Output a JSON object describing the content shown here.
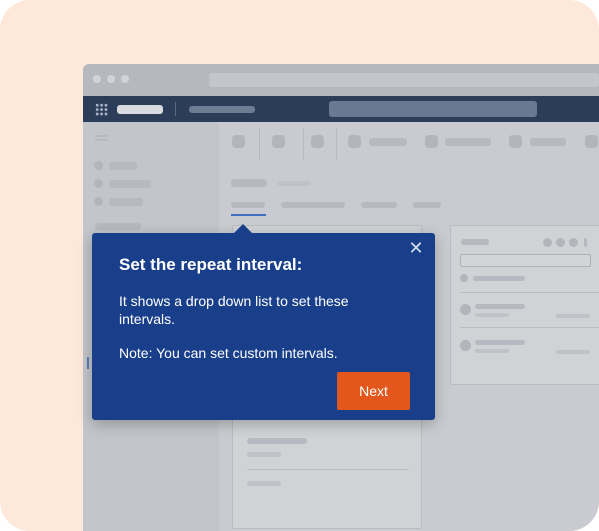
{
  "tour_popover": {
    "title": "Set the repeat interval:",
    "body": "It shows a drop down list to set these intervals.",
    "note": "Note: You can set custom intervals.",
    "next_label": "Next",
    "close_glyph": "✕"
  },
  "colors": {
    "popover_bg": "#1a3f8a",
    "next_button": "#e4571c",
    "frame_bg": "#fde8da",
    "navbar_bg": "#2c3d59",
    "accent": "#3e6fbf"
  }
}
